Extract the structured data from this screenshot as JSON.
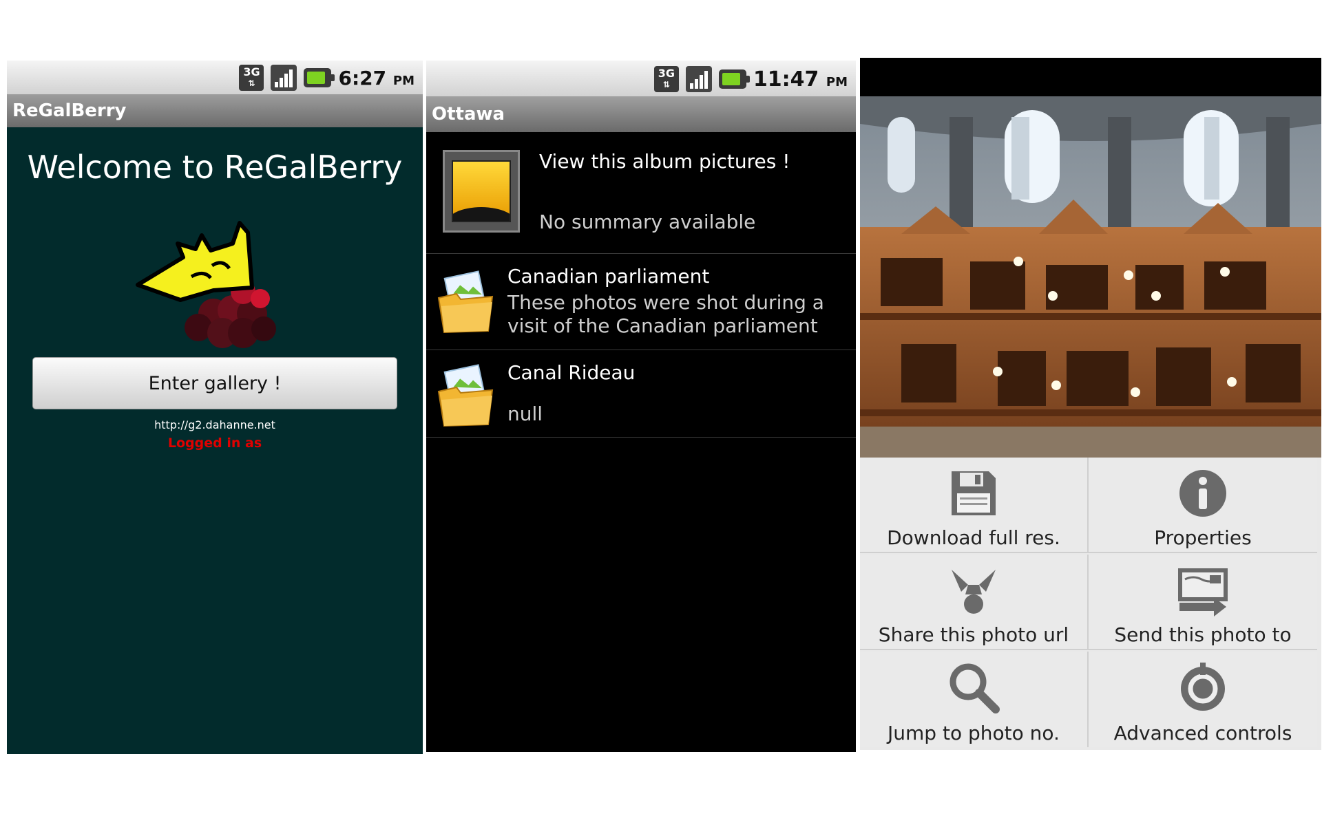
{
  "screen1": {
    "status": {
      "time": "6:27",
      "ampm": "PM",
      "network": "3G"
    },
    "title": "ReGalBerry",
    "welcome": "Welcome to ReGalBerry",
    "enter_button": "Enter gallery !",
    "url": "http://g2.dahanne.net",
    "logged_in": "Logged in as"
  },
  "screen2": {
    "status": {
      "time": "11:47",
      "ampm": "PM",
      "network": "3G"
    },
    "title": "Ottawa",
    "items": [
      {
        "title": "View this album pictures !",
        "subtitle": "No summary available"
      },
      {
        "title": "Canadian parliament",
        "subtitle": "These photos were shot during a visit of the Canadian parliament"
      },
      {
        "title": "Canal Rideau",
        "subtitle": "null"
      }
    ]
  },
  "screen3": {
    "menu": [
      {
        "label": "Download full res.",
        "icon": "floppy-icon"
      },
      {
        "label": "Properties",
        "icon": "info-icon"
      },
      {
        "label": "Share this photo url",
        "icon": "share-icon"
      },
      {
        "label": "Send this photo to",
        "icon": "send-icon"
      },
      {
        "label": "Jump to photo no.",
        "icon": "search-icon"
      },
      {
        "label": "Advanced controls",
        "icon": "power-icon"
      }
    ]
  },
  "colors": {
    "screen1_bg": "#022b2c",
    "logged_in_text": "#e00000",
    "crown_yellow": "#f5f01e",
    "folder_yellow": "#f2b632"
  }
}
